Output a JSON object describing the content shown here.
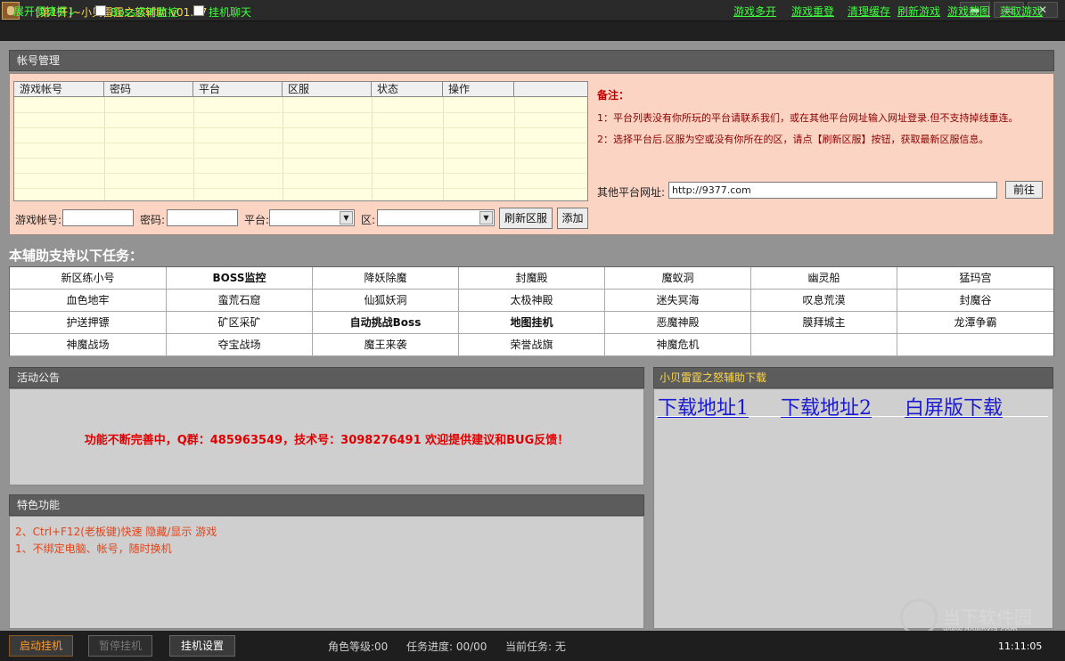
{
  "window": {
    "title": "[第1开]~小贝雷霆之怒辅助 v01.07",
    "buttons": {
      "minimize": "▬",
      "maximize": "▭",
      "close": "✕"
    }
  },
  "toolbar": {
    "toggle_quick": "展开便捷框↓",
    "boss_monitor": "Boss实时监控",
    "chat_afk": "挂机聊天",
    "right_links": [
      "游戏多开",
      "游戏重登",
      "清理缓存",
      "刷新游戏",
      "游戏截图",
      "获取游戏"
    ]
  },
  "account": {
    "header": "帐号管理",
    "columns": [
      "游戏帐号",
      "密码",
      "平台",
      "区服",
      "状态",
      "操作",
      ""
    ],
    "form": {
      "account_label": "游戏帐号:",
      "password_label": "密码:",
      "platform_label": "平台:",
      "zone_label": "区:",
      "refresh_button": "刷新区服",
      "add_button": "添加"
    },
    "notes": {
      "title": "备注：",
      "line1": "1：平台列表没有你所玩的平台请联系我们，或在其他平台网址输入网址登录.但不支持掉线重连。",
      "line2": "2：选择平台后.区服为空或没有你所在的区，请点【刷新区服】按钮，获取最新区服信息。"
    },
    "other_url_label": "其他平台网址:",
    "other_url_value": "http://9377.com",
    "go_button": "前往"
  },
  "tasks": {
    "title": "本辅助支持以下任务：",
    "rows": [
      [
        "新区练小号",
        "BOSS监控",
        "降妖除魔",
        "封魔殿",
        "魔蚁洞",
        "幽灵船",
        "猛玛宫"
      ],
      [
        "血色地牢",
        "蛮荒石窟",
        "仙狐妖洞",
        "太极神殿",
        "迷失冥海",
        "叹息荒漠",
        "封魔谷"
      ],
      [
        "护送押镖",
        "矿区采矿",
        "自动挑战Boss",
        "地图挂机",
        "恶魔神殿",
        "膜拜城主",
        "龙潭争霸"
      ],
      [
        "神魔战场",
        "夺宝战场",
        "魔王来袭",
        "荣誉战旗",
        "神魔危机",
        "",
        ""
      ]
    ],
    "bold_cells": [
      "BOSS监控",
      "自动挑战Boss",
      "地图挂机"
    ]
  },
  "activity": {
    "header": "活动公告",
    "message": "功能不断完善中，Q群：485963549，技术号：3098276491 欢迎提供建议和BUG反馈！"
  },
  "features": {
    "header": "特色功能",
    "lines": [
      "2、Ctrl+F12(老板键)快速 隐藏/显示 游戏",
      "1、不绑定电脑、帐号，随时换机"
    ]
  },
  "download": {
    "header": "小贝雷霆之怒辅助下载",
    "links": [
      "下载地址1",
      "下载地址2",
      "白屏版下载"
    ]
  },
  "watermark": {
    "text": "当下软件园",
    "url": "www.downxia.com"
  },
  "statusbar": {
    "start_button": "启动挂机",
    "pause_button": "暂停挂机",
    "settings_button": "挂机设置",
    "role_level": "角色等级:00",
    "task_progress": "任务进度:  00/00",
    "current_task": "当前任务:  无",
    "clock": "11:11:05"
  },
  "colors": {
    "accent_green": "#3dff3d",
    "title_yellow": "#ffd84a",
    "notice_red": "#e00000",
    "note_bg": "#fcd4c4"
  }
}
